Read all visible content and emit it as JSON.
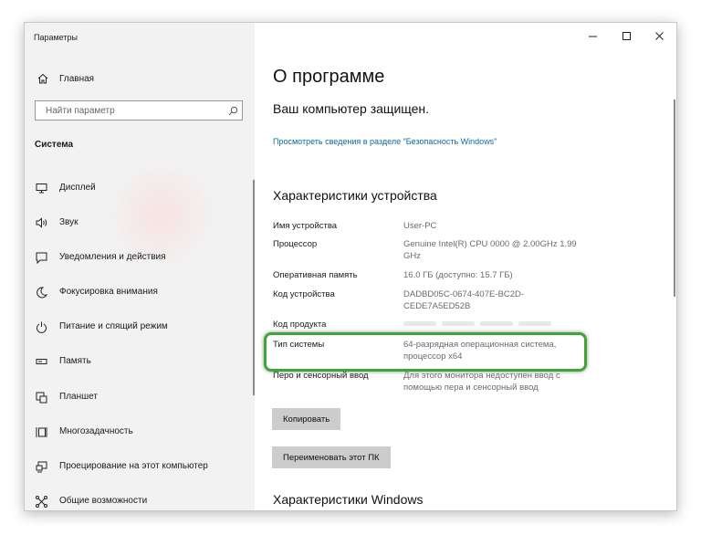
{
  "window": {
    "app_title": "Параметры",
    "controls": {
      "minimize": "–",
      "maximize": "☐",
      "close": "✕"
    }
  },
  "sidebar": {
    "home_label": "Главная",
    "search_placeholder": "Найти параметр",
    "section_title": "Система",
    "items": [
      {
        "label": "Дисплей",
        "icon": "monitor-icon"
      },
      {
        "label": "Звук",
        "icon": "speaker-icon"
      },
      {
        "label": "Уведомления и действия",
        "icon": "notification-icon"
      },
      {
        "label": "Фокусировка внимания",
        "icon": "moon-icon"
      },
      {
        "label": "Питание и спящий режим",
        "icon": "power-icon"
      },
      {
        "label": "Память",
        "icon": "storage-icon"
      },
      {
        "label": "Планшет",
        "icon": "tablet-icon"
      },
      {
        "label": "Многозадачность",
        "icon": "multitasking-icon"
      },
      {
        "label": "Проецирование на этот компьютер",
        "icon": "projecting-icon"
      },
      {
        "label": "Общие возможности",
        "icon": "shared-experiences-icon"
      }
    ]
  },
  "main": {
    "page_title": "О программе",
    "protected_text": "Ваш компьютер защищен.",
    "security_link": "Просмотреть сведения в разделе \"Безопасность Windows\"",
    "device_specs_title": "Характеристики устройства",
    "specs": [
      {
        "label": "Имя устройства",
        "value": "User-PC"
      },
      {
        "label": "Процессор",
        "value": "Genuine Intel(R) CPU 0000 @ 2.00GHz 1.99 GHz"
      },
      {
        "label": "Оперативная память",
        "value": "16.0 ГБ (доступно: 15.7 ГБ)"
      },
      {
        "label": "Код устройства",
        "value": "DADBD05C-0674-407E-BC2D-CEDE7A5ED52B"
      },
      {
        "label": "Код продукта",
        "value": ""
      },
      {
        "label": "Тип системы",
        "value": "64-разрядная операционная система, процессор x64"
      },
      {
        "label": "Перо и сенсорный ввод",
        "value": "Для этого монитора недоступен ввод с помощью пера и сенсорный ввод"
      }
    ],
    "copy_button": "Копировать",
    "rename_button": "Переименовать этот ПК",
    "windows_specs_title": "Характеристики Windows"
  },
  "colors": {
    "sidebar_bg": "#f2f2f2",
    "link": "#0b6a9c",
    "highlight": "#3fa43a",
    "button_bg": "#cccccc"
  }
}
